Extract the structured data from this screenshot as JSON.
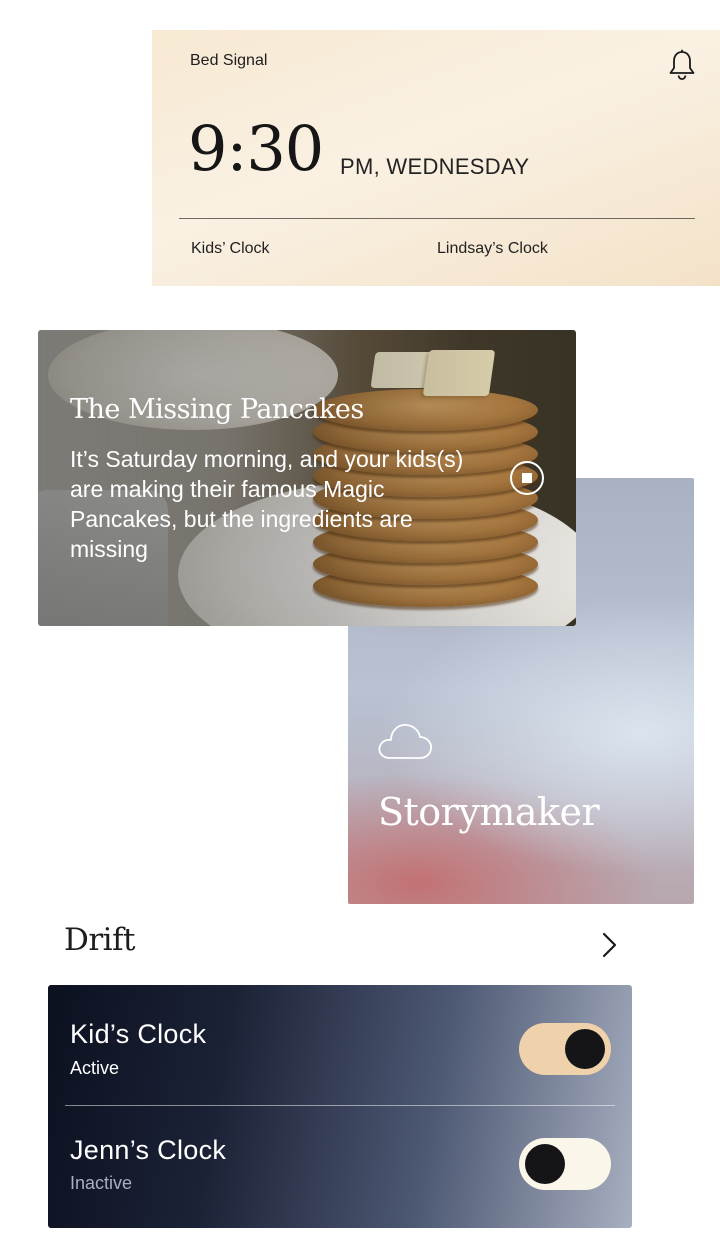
{
  "bed_signal": {
    "title": "Bed Signal",
    "time": "9:30",
    "time_suffix": "PM, WEDNESDAY",
    "clocks": [
      "Kids’ Clock",
      "Lindsay’s Clock"
    ]
  },
  "story_card": {
    "title": "The Missing Pancakes",
    "description": "It’s Saturday morning, and your kids(s) are making their famous Magic Pancakes, but the ingredients are missing"
  },
  "storymaker": {
    "title": "Storymaker",
    "icon": "cloud-icon"
  },
  "drift": {
    "title": "Drift",
    "clocks": [
      {
        "name": "Kid’s Clock",
        "status": "Active",
        "enabled": true
      },
      {
        "name": "Jenn’s Clock",
        "status": "Inactive",
        "enabled": false
      }
    ]
  },
  "colors": {
    "signal_bg": "#f7e9d2",
    "toggle_on": "#efd2ac",
    "toggle_off": "#fbf6ea",
    "drift_panel_dark": "#0c1120"
  }
}
